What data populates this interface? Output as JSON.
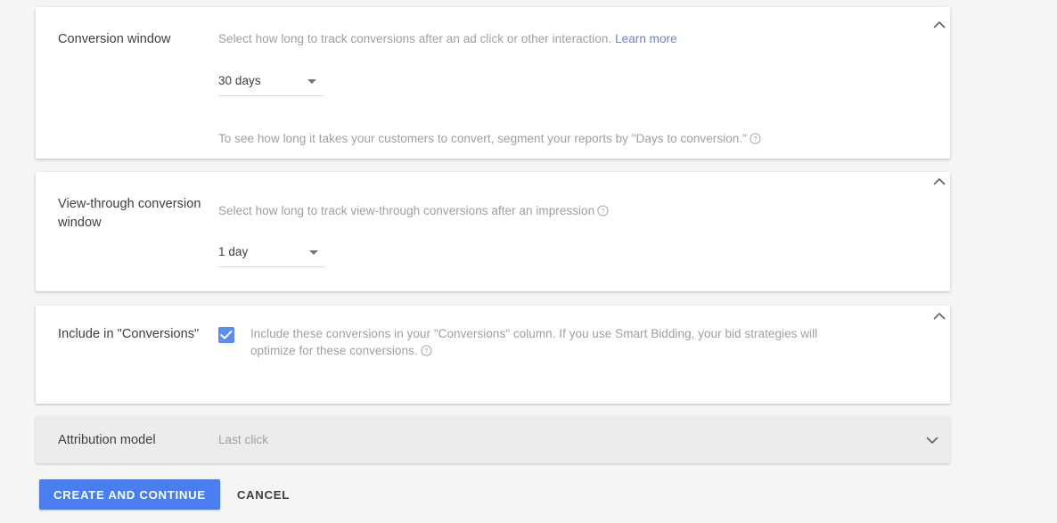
{
  "cards": [
    {
      "id": "conversion-window",
      "title": "Conversion window",
      "description_text": "Select how long to track conversions after an ad click or other interaction.",
      "description_link": "Learn more",
      "select_value": "30 days",
      "footnote": "To see how long it takes your customers to convert, segment your reports by \"Days to conversion.\"",
      "collapse_icon": "chevron-up-icon"
    },
    {
      "id": "view-through-conversion-window",
      "title": "View-through conversion window",
      "description_text": "Select how long to track view-through conversions after an impression",
      "select_value": "1 day",
      "collapse_icon": "chevron-up-icon"
    },
    {
      "id": "include-in-conversions",
      "title": "Include in \"Conversions\"",
      "checkbox_checked": true,
      "checkbox_label": "Include these conversions in your \"Conversions\" column. If you use Smart Bidding, your bid strategies will optimize for these conversions.",
      "collapse_icon": "chevron-up-icon"
    },
    {
      "id": "attribution-model",
      "title": "Attribution model",
      "value": "Last click",
      "collapsed": true,
      "collapse_icon": "chevron-down-icon"
    }
  ],
  "actions": {
    "primary_label": "CREATE AND CONTINUE",
    "secondary_label": "CANCEL"
  },
  "colors": {
    "accent_blue": "#4a7ef0",
    "checkbox_blue": "#5c8df6",
    "link_blue": "#6b7fd7",
    "page_background": "#f5f5f5",
    "card_background": "#ffffff",
    "collapsed_card_background": "#ececec",
    "muted_text": "#9aa0a6",
    "title_text": "#3c4043"
  }
}
